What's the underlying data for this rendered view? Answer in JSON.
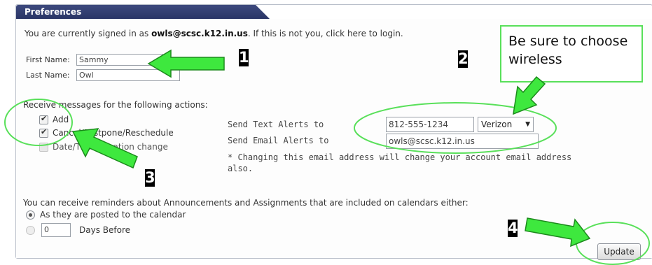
{
  "panel": {
    "title": "Preferences"
  },
  "signin": {
    "prefix": "You are currently signed in as ",
    "email": "owls@scsc.k12.in.us",
    "suffix": ". If this is not you, click here to login."
  },
  "name": {
    "first_label": "First Name:",
    "first_value": "Sammy",
    "last_label": "Last Name:",
    "last_value": "Owl"
  },
  "actions": {
    "heading": "Receive messages for the following actions:",
    "items": [
      {
        "label": "Add",
        "checked": true
      },
      {
        "label": "Cancel/Postpone/Reschedule",
        "checked": true
      },
      {
        "label": "Date/Time/Location change",
        "checked": false
      }
    ]
  },
  "alerts": {
    "text_label": "Send Text Alerts to",
    "text_value": "812-555-1234",
    "carrier": "Verizon",
    "email_label": "Send Email Alerts to",
    "email_value": "owls@scsc.k12.in.us",
    "note": "* Changing this email address will change your account email address also."
  },
  "reminders": {
    "heading": "You can receive reminders about Announcements and Assignments that are included on calendars either:",
    "option_posted": "As they are posted to the calendar",
    "days_value": "0",
    "days_label": "Days Before"
  },
  "update_button": "Update",
  "annotations": {
    "callout": "Be sure to choose wireless",
    "numbers": [
      "1",
      "2",
      "3",
      "4"
    ],
    "green": "#3ee83e",
    "outline_green": "#59e05a"
  }
}
